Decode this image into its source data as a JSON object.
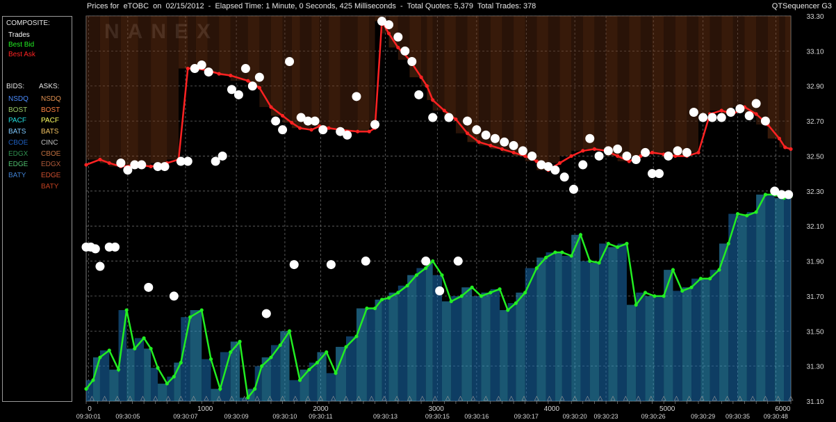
{
  "header": {
    "title": "Prices for  eTOBC  on  02/15/2012  -  Elapsed Time: 1 Minute, 0 Seconds, 425 Milliseconds  -  Total Quotes: 5,379  Total Trades: 378",
    "app_name": "QTSequencer G3"
  },
  "legend": {
    "composite_heading": "COMPOSITE:",
    "composite": [
      {
        "label": "Trades",
        "color": "#ffffff"
      },
      {
        "label": "Best Bid",
        "color": "#22ee22"
      },
      {
        "label": "Best Ask",
        "color": "#ff2222"
      }
    ],
    "bids_heading": "BIDS:",
    "asks_heading": "ASKS:",
    "bids": [
      {
        "label": "NSDQ",
        "color": "#4a8cff"
      },
      {
        "label": "BOST",
        "color": "#9ccc6a"
      },
      {
        "label": "PACF",
        "color": "#22e0e0"
      },
      {
        "label": "BATS",
        "color": "#7ec8ff"
      },
      {
        "label": "CBOE",
        "color": "#1f5fbf"
      },
      {
        "label": "EDGX",
        "color": "#2f8f4f"
      },
      {
        "label": "EDGE",
        "color": "#4fbf6f"
      },
      {
        "label": "BATY",
        "color": "#3f7fcf"
      }
    ],
    "asks": [
      {
        "label": "NSDQ",
        "color": "#e09050"
      },
      {
        "label": "BOST",
        "color": "#ff8040"
      },
      {
        "label": "PACF",
        "color": "#ffff60"
      },
      {
        "label": "BATS",
        "color": "#f0c060"
      },
      {
        "label": "CINC",
        "color": "#c0c0c0"
      },
      {
        "label": "CBOE",
        "color": "#c07040"
      },
      {
        "label": "EDGX",
        "color": "#b05a3a"
      },
      {
        "label": "EDGE",
        "color": "#d05030"
      },
      {
        "label": "BATY",
        "color": "#c04020"
      }
    ]
  },
  "chart_data": {
    "type": "line",
    "title": "",
    "xlabel": "",
    "ylabel": "",
    "watermark": "NANEX",
    "ylim": [
      31.1,
      33.3
    ],
    "xlim": [
      0,
      6100
    ],
    "y_ticks": [
      "31.10",
      "31.30",
      "31.50",
      "31.70",
      "31.90",
      "32.10",
      "32.30",
      "32.50",
      "32.70",
      "32.90",
      "33.10",
      "33.30"
    ],
    "x_ticks": [
      {
        "value": 0,
        "label": "0"
      },
      {
        "value": 1000,
        "label": "1000"
      },
      {
        "value": 2000,
        "label": "2000"
      },
      {
        "value": 3000,
        "label": "3000"
      },
      {
        "value": 4000,
        "label": "4000"
      },
      {
        "value": 5000,
        "label": "5000"
      },
      {
        "value": 6000,
        "label": "6000"
      }
    ],
    "time_labels": [
      {
        "x": 20,
        "label": "09:30:01"
      },
      {
        "x": 360,
        "label": "09:30:05"
      },
      {
        "x": 860,
        "label": "09:30:07"
      },
      {
        "x": 1300,
        "label": "09:30:09"
      },
      {
        "x": 1720,
        "label": "09:30:10"
      },
      {
        "x": 2030,
        "label": "09:30:11"
      },
      {
        "x": 2590,
        "label": "09:30:13"
      },
      {
        "x": 3040,
        "label": "09:30:15"
      },
      {
        "x": 3380,
        "label": "09:30:16"
      },
      {
        "x": 3810,
        "label": "09:30:17"
      },
      {
        "x": 4230,
        "label": "09:30:20"
      },
      {
        "x": 4500,
        "label": "09:30:23"
      },
      {
        "x": 4910,
        "label": "09:30:26"
      },
      {
        "x": 5340,
        "label": "09:30:29"
      },
      {
        "x": 5640,
        "label": "09:30:35"
      },
      {
        "x": 5970,
        "label": "09:30:48"
      }
    ],
    "series": [
      {
        "name": "Best Ask",
        "color": "#ff2222",
        "x": [
          0,
          120,
          200,
          300,
          450,
          560,
          700,
          800,
          880,
          950,
          1050,
          1150,
          1250,
          1400,
          1500,
          1600,
          1700,
          1780,
          1850,
          1950,
          2020,
          2100,
          2200,
          2350,
          2450,
          2500,
          2560,
          2620,
          2700,
          2800,
          2900,
          2950,
          3000,
          3100,
          3200,
          3300,
          3400,
          3500,
          3600,
          3700,
          3800,
          3900,
          4000,
          4100,
          4200,
          4300,
          4400,
          4500,
          4600,
          4700,
          4800,
          4900,
          5000,
          5100,
          5200,
          5300,
          5400,
          5500,
          5600,
          5700,
          5800,
          5900,
          6000,
          6050,
          6100
        ],
        "values": [
          32.45,
          32.48,
          32.46,
          32.44,
          32.45,
          32.44,
          32.46,
          32.48,
          33.0,
          33.0,
          32.99,
          32.97,
          32.96,
          32.93,
          32.89,
          32.78,
          32.73,
          32.69,
          32.66,
          32.65,
          32.67,
          32.66,
          32.65,
          32.64,
          32.64,
          32.66,
          33.27,
          33.2,
          33.12,
          33.05,
          32.95,
          32.9,
          32.82,
          32.76,
          32.71,
          32.63,
          32.58,
          32.56,
          32.54,
          32.52,
          32.5,
          32.47,
          32.42,
          32.46,
          32.5,
          32.53,
          32.54,
          32.53,
          32.5,
          32.47,
          32.5,
          32.52,
          32.51,
          32.5,
          32.5,
          32.52,
          32.74,
          32.76,
          32.74,
          32.78,
          32.74,
          32.68,
          32.6,
          32.55,
          32.54
        ]
      },
      {
        "name": "Best Bid",
        "color": "#22ee22",
        "x": [
          0,
          60,
          120,
          200,
          280,
          350,
          420,
          500,
          560,
          620,
          700,
          760,
          820,
          900,
          1000,
          1080,
          1160,
          1250,
          1330,
          1400,
          1460,
          1520,
          1600,
          1680,
          1760,
          1850,
          1930,
          2000,
          2080,
          2160,
          2250,
          2340,
          2430,
          2500,
          2560,
          2620,
          2700,
          2780,
          2860,
          2940,
          3000,
          3080,
          3160,
          3250,
          3340,
          3420,
          3500,
          3580,
          3650,
          3720,
          3800,
          3900,
          3980,
          4060,
          4120,
          4200,
          4280,
          4360,
          4440,
          4520,
          4600,
          4680,
          4760,
          4840,
          4920,
          5000,
          5080,
          5160,
          5240,
          5320,
          5400,
          5480,
          5560,
          5640,
          5720,
          5800,
          5880,
          5960,
          6040,
          6100
        ],
        "values": [
          31.17,
          31.22,
          31.35,
          31.39,
          31.28,
          31.62,
          31.4,
          31.46,
          31.4,
          31.29,
          31.2,
          31.24,
          31.32,
          31.58,
          31.62,
          31.34,
          31.17,
          31.38,
          31.44,
          31.12,
          31.17,
          31.3,
          31.35,
          31.42,
          31.5,
          31.22,
          31.28,
          31.32,
          31.38,
          31.26,
          31.41,
          31.47,
          31.63,
          31.63,
          31.68,
          31.69,
          31.72,
          31.76,
          31.82,
          31.86,
          31.9,
          31.82,
          31.67,
          31.7,
          31.75,
          31.7,
          31.72,
          31.74,
          31.62,
          31.66,
          31.72,
          31.86,
          31.92,
          31.95,
          31.95,
          31.93,
          32.05,
          31.9,
          31.89,
          32.0,
          31.98,
          32.0,
          31.65,
          31.72,
          31.7,
          31.7,
          31.85,
          31.73,
          31.75,
          31.8,
          31.8,
          31.85,
          32.0,
          32.17,
          32.16,
          32.18,
          32.28,
          32.28,
          32.26,
          32.27
        ]
      }
    ],
    "trades": {
      "name": "Trades",
      "color": "#ffffff",
      "x": [
        0,
        40,
        80,
        120,
        200,
        250,
        300,
        360,
        420,
        480,
        540,
        620,
        680,
        760,
        820,
        880,
        940,
        1000,
        1060,
        1120,
        1180,
        1260,
        1320,
        1380,
        1440,
        1500,
        1560,
        1640,
        1700,
        1760,
        1800,
        1860,
        1920,
        1980,
        2050,
        2120,
        2200,
        2260,
        2340,
        2420,
        2500,
        2560,
        2620,
        2700,
        2760,
        2820,
        2880,
        2940,
        3000,
        3060,
        3140,
        3220,
        3300,
        3380,
        3460,
        3540,
        3620,
        3700,
        3780,
        3860,
        3940,
        4000,
        4060,
        4140,
        4220,
        4300,
        4360,
        4440,
        4520,
        4600,
        4680,
        4760,
        4840,
        4900,
        4960,
        5040,
        5120,
        5200,
        5260,
        5340,
        5420,
        5500,
        5580,
        5660,
        5740,
        5800,
        5880,
        5960,
        6020,
        6080
      ],
      "values": [
        31.98,
        31.98,
        31.97,
        31.87,
        31.98,
        31.98,
        32.46,
        32.42,
        32.45,
        32.45,
        31.75,
        32.44,
        32.44,
        31.7,
        32.47,
        32.47,
        33.0,
        33.02,
        32.98,
        32.47,
        32.5,
        32.88,
        32.85,
        33.0,
        32.9,
        32.95,
        31.6,
        32.7,
        32.65,
        33.04,
        31.88,
        32.72,
        32.7,
        32.7,
        32.65,
        31.88,
        32.64,
        32.62,
        32.84,
        31.9,
        32.68,
        33.27,
        33.25,
        33.18,
        33.1,
        33.04,
        32.85,
        31.9,
        32.72,
        31.73,
        32.72,
        31.9,
        32.7,
        32.65,
        32.62,
        32.6,
        32.58,
        32.56,
        32.53,
        32.5,
        32.45,
        32.44,
        32.42,
        32.38,
        32.31,
        32.45,
        32.6,
        32.5,
        32.53,
        32.54,
        32.5,
        32.48,
        32.52,
        32.4,
        32.4,
        32.5,
        32.53,
        32.52,
        32.75,
        32.72,
        32.72,
        32.72,
        32.75,
        32.77,
        32.73,
        32.8,
        32.7,
        32.3,
        32.28,
        32.28
      ]
    }
  }
}
